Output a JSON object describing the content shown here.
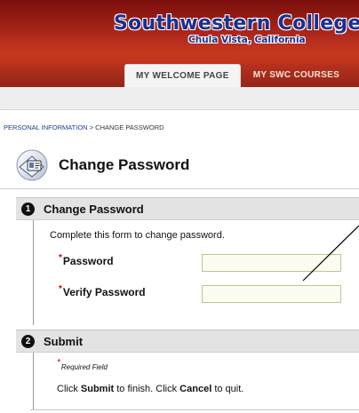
{
  "header": {
    "college_name": "Southwestern College",
    "location": "Chula Vista, California"
  },
  "tabs": [
    {
      "label": "MY WELCOME PAGE",
      "active": true
    },
    {
      "label": "MY SWC COURSES",
      "active": false
    }
  ],
  "breadcrumb": {
    "parent": "PERSONAL INFORMATION",
    "separator": ">",
    "current": "CHANGE PASSWORD"
  },
  "page": {
    "title": "Change Password",
    "icon": "id-card-icon"
  },
  "section1": {
    "number": "1",
    "title": "Change Password",
    "intro": "Complete this form to change password.",
    "required_marker": "*",
    "fields": [
      {
        "label": "Password",
        "value": "",
        "placeholder": ""
      },
      {
        "label": "Verify Password",
        "value": "",
        "placeholder": ""
      }
    ]
  },
  "section2": {
    "number": "2",
    "title": "Submit",
    "required_note": "Required Field",
    "instr_click": "Click",
    "instr_submit": "Submit",
    "instr_middle": "to finish. Click",
    "instr_cancel": "Cancel",
    "instr_end": "to quit."
  },
  "colors": {
    "header_red": "#b52d1c",
    "logo_blue": "#1c2f8f",
    "required_red": "#cc0000",
    "input_bg": "#fcfdf0",
    "input_border": "#b9c88f"
  }
}
